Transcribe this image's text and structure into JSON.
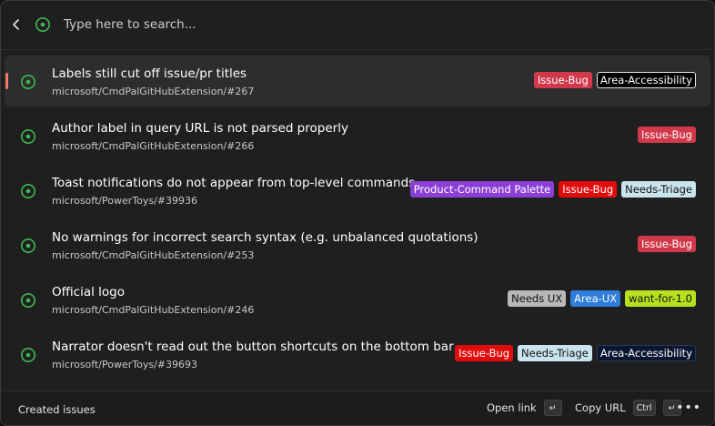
{
  "search": {
    "placeholder": "Type here to search..."
  },
  "issues": [
    {
      "title": "Labels still cut off issue/pr titles",
      "repo": "microsoft/CmdPalGitHubExtension/#267",
      "selected": true,
      "labels": [
        {
          "text": "Issue-Bug",
          "bg": "#d1394b",
          "fg": "#ffffff"
        },
        {
          "text": "Area-Accessibility",
          "bg": "#000000",
          "fg": "#ffffff",
          "border": "#e6e6e6"
        }
      ]
    },
    {
      "title": "Author label in query URL is not parsed properly",
      "repo": "microsoft/CmdPalGitHubExtension/#266",
      "labels": [
        {
          "text": "Issue-Bug",
          "bg": "#d1394b",
          "fg": "#ffffff"
        }
      ]
    },
    {
      "title": "Toast notifications do not appear from top-level commands",
      "repo": "microsoft/PowerToys/#39936",
      "labels": [
        {
          "text": "Product-Command Palette",
          "bg": "#8b3fd6",
          "fg": "#ffffff"
        },
        {
          "text": "Issue-Bug",
          "bg": "#e20b0b",
          "fg": "#ffffff"
        },
        {
          "text": "Needs-Triage",
          "bg": "#c9e4ee",
          "fg": "#111111"
        }
      ]
    },
    {
      "title": "No warnings for incorrect search syntax (e.g. unbalanced quotations)",
      "repo": "microsoft/CmdPalGitHubExtension/#253",
      "labels": [
        {
          "text": "Issue-Bug",
          "bg": "#d1394b",
          "fg": "#ffffff"
        }
      ]
    },
    {
      "title": "Official logo",
      "repo": "microsoft/CmdPalGitHubExtension/#246",
      "labels": [
        {
          "text": "Needs UX",
          "bg": "#b8b8b8",
          "fg": "#111111"
        },
        {
          "text": "Area-UX",
          "bg": "#2e7dd8",
          "fg": "#ffffff"
        },
        {
          "text": "want-for-1.0",
          "bg": "#b7e11f",
          "fg": "#111111"
        }
      ]
    },
    {
      "title": "Narrator doesn't read out the button shortcuts on the bottom bar",
      "repo": "microsoft/PowerToys/#39693",
      "labels": [
        {
          "text": "Issue-Bug",
          "bg": "#e20b0b",
          "fg": "#ffffff"
        },
        {
          "text": "Needs-Triage",
          "bg": "#c9e4ee",
          "fg": "#111111"
        },
        {
          "text": "Area-Accessibility",
          "bg": "#0a1530",
          "fg": "#ffffff",
          "border": "#2a3a5a"
        }
      ]
    }
  ],
  "footer": {
    "title": "Created issues",
    "open_link_label": "Open link",
    "copy_url_label": "Copy URL",
    "ctrl_key": "Ctrl",
    "enter_key": "↵",
    "more_label": "•••"
  },
  "colors": {
    "issue_open": "#3fb950",
    "accent": "#f07a6a"
  }
}
